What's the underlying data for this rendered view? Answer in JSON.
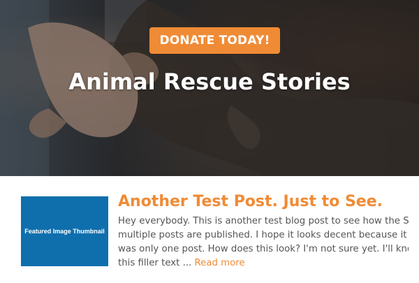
{
  "hero": {
    "donate_label": "DONATE TODAY!",
    "title": "Animal Rescue Stories"
  },
  "post": {
    "thumbnail_text": "Featured Image Thumbnail",
    "title": "Another Test Post. Just to See.",
    "excerpt_lines": [
      "Hey everybody. This is another test blog post to see how the Stories",
      "multiple posts are published. I hope it looks decent because it was r",
      "was only one post. How does this look? I'm not sure yet. I'll know wl",
      "this filler text ..."
    ],
    "read_more": "Read more"
  },
  "colors": {
    "accent": "#f08b35",
    "thumbnail": "#0f6fad",
    "body_text": "#555555"
  }
}
